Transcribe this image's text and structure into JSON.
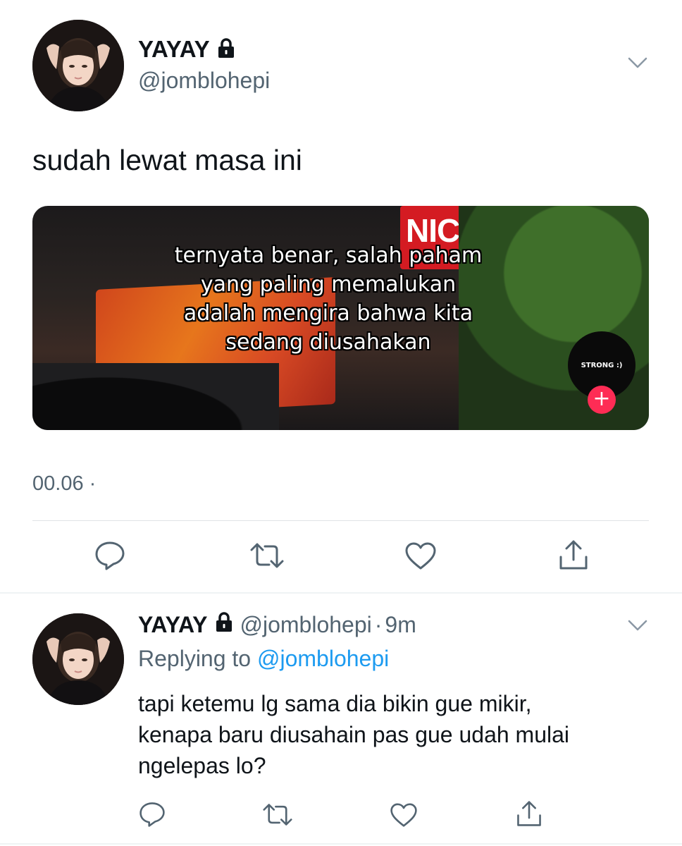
{
  "tweet": {
    "name": "YAYAY",
    "handle": "@jomblohepi",
    "text": "sudah lewat masa ini",
    "time": "00.06 ·",
    "media": {
      "caption_lines": [
        "ternyata benar, salah paham",
        "yang paling memalukan",
        "adalah mengira bahwa kita",
        "sedang diusahakan"
      ],
      "sign_text": "NICE",
      "badge_text": "STRONG :)",
      "plus_symbol": "+"
    }
  },
  "reply": {
    "name": "YAYAY",
    "handle": "@jomblohepi",
    "dot": "·",
    "time": "9m",
    "replying_label": "Replying to",
    "replying_handle": "@jomblohepi",
    "text_lines": [
      "tapi ketemu lg sama dia bikin gue mikir,",
      "kenapa baru diusahain pas gue udah mulai",
      "ngelepas lo?"
    ]
  },
  "icons": {
    "reply": "reply-icon",
    "retweet": "retweet-icon",
    "like": "heart-icon",
    "share": "share-icon",
    "lock": "lock-icon",
    "more": "chevron-down-icon"
  },
  "colors": {
    "text": "#0f1419",
    "secondary": "#536471",
    "link": "#1d9bf0",
    "divider": "#dfe3e6"
  }
}
